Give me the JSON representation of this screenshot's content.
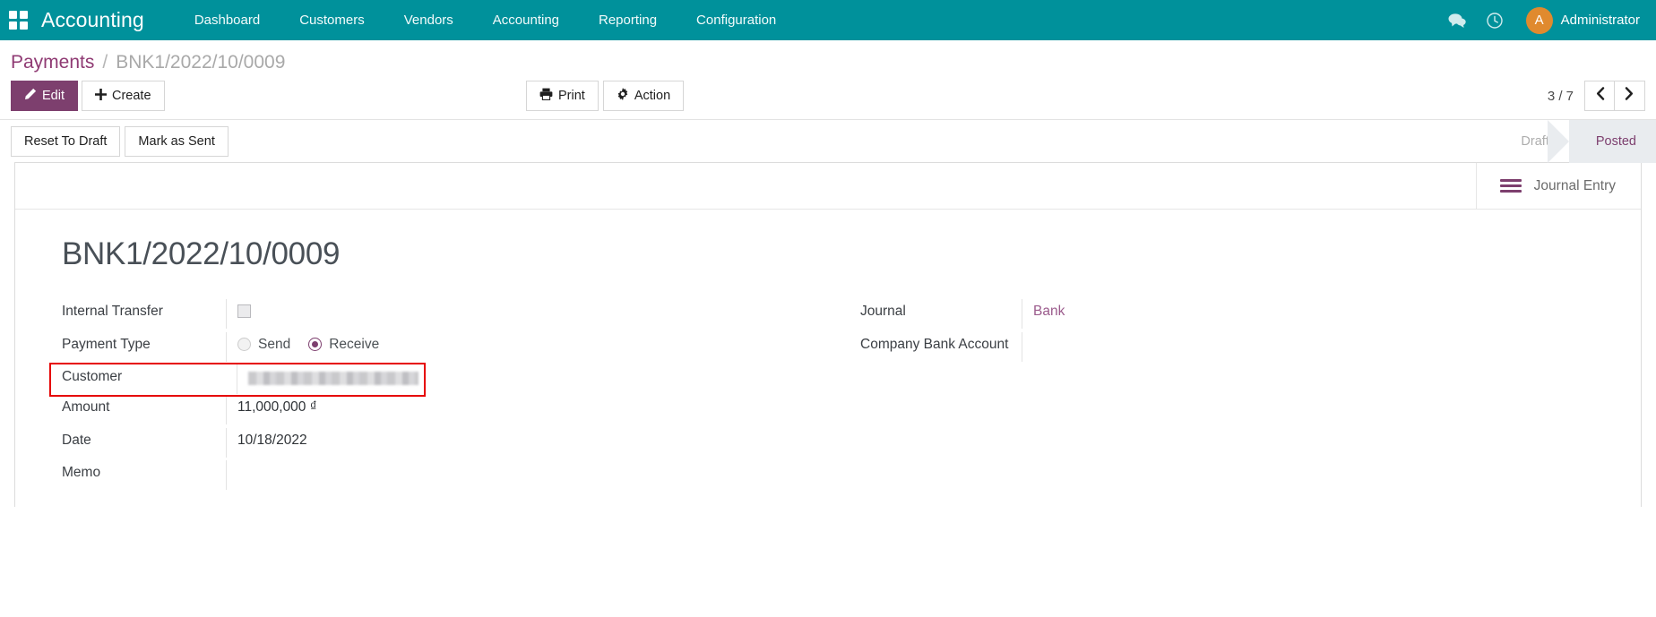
{
  "navbar": {
    "apps_icon": "apps-grid-icon",
    "brand": "Accounting",
    "menu": [
      {
        "label": "Dashboard"
      },
      {
        "label": "Customers"
      },
      {
        "label": "Vendors"
      },
      {
        "label": "Accounting"
      },
      {
        "label": "Reporting"
      },
      {
        "label": "Configuration"
      }
    ],
    "messages_icon": "chat-bubble-icon",
    "activities_icon": "clock-icon",
    "avatar_initial": "A",
    "user_name": "Administrator",
    "bg_color": "#00919b"
  },
  "breadcrumb": {
    "root": "Payments",
    "separator": "/",
    "current": "BNK1/2022/10/0009"
  },
  "control_panel": {
    "edit_label": "Edit",
    "edit_icon": "pencil-icon",
    "create_label": "Create",
    "create_icon": "plus-icon",
    "print_label": "Print",
    "print_icon": "printer-icon",
    "action_label": "Action",
    "action_icon": "gear-icon",
    "pager_count": "3 / 7",
    "prev_icon": "chevron-left-icon",
    "next_icon": "chevron-right-icon"
  },
  "status_row": {
    "reset_label": "Reset To Draft",
    "mark_sent_label": "Mark as Sent",
    "stages": [
      {
        "label": "Draft",
        "active": false
      },
      {
        "label": "Posted",
        "active": true
      }
    ],
    "active_color": "#7d3f6e"
  },
  "sheet": {
    "smart_button": {
      "label": "Journal Entry",
      "icon": "bars-icon"
    },
    "title": "BNK1/2022/10/0009",
    "left_fields": [
      {
        "label": "Internal Transfer",
        "type": "checkbox",
        "value": ""
      },
      {
        "label": "Payment Type",
        "type": "radio",
        "options": [
          "Send",
          "Receive"
        ],
        "selected": "Receive"
      },
      {
        "label": "Customer",
        "type": "redacted",
        "value": "",
        "highlighted": true
      },
      {
        "label": "Amount",
        "type": "text",
        "value": "11,000,000 ₫"
      },
      {
        "label": "Date",
        "type": "text",
        "value": "10/18/2022"
      },
      {
        "label": "Memo",
        "type": "text",
        "value": ""
      }
    ],
    "right_fields": [
      {
        "label": "Journal",
        "type": "link",
        "value": "Bank"
      },
      {
        "label": "Company Bank Account",
        "type": "text",
        "value": ""
      }
    ]
  }
}
